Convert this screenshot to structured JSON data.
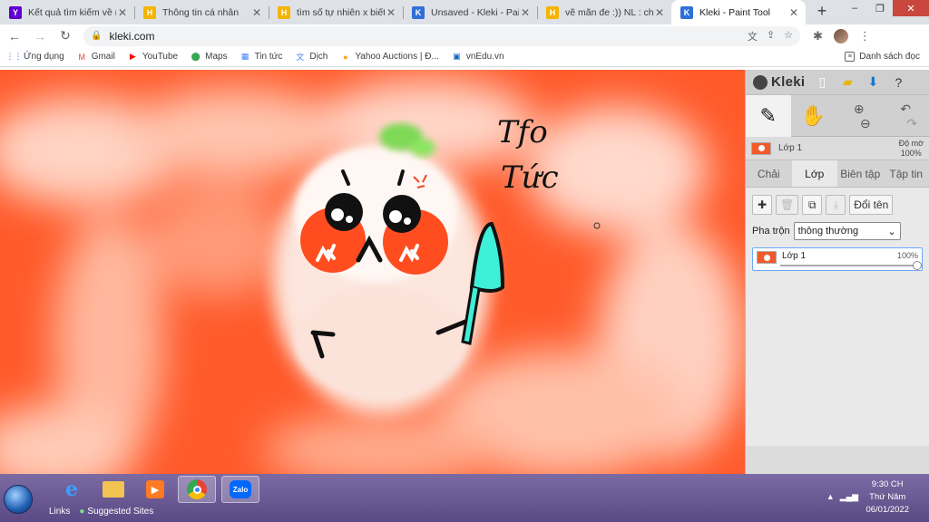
{
  "browser": {
    "tabs": [
      {
        "title": "Kết quả tìm kiếm về nếu",
        "fav": "Y",
        "fav_color": "#5f01d1"
      },
      {
        "title": "Thông tin cá nhân",
        "fav": "H",
        "fav_color": "#f5b400"
      },
      {
        "title": "tìm số tự nhiên x biết a)",
        "fav": "H",
        "fav_color": "#f5b400"
      },
      {
        "title": "Unsaved - Kleki - Paint T",
        "fav": "K",
        "fav_color": "#2f6fd6"
      },
      {
        "title": "vẽ mãn đe :)) NL : chân d",
        "fav": "H",
        "fav_color": "#f5b400"
      },
      {
        "title": "Kleki - Paint Tool",
        "fav": "K",
        "fav_color": "#2f6fd6"
      }
    ],
    "url": "kleki.com",
    "bookmarks": [
      {
        "label": "Ứng dụng",
        "icon": "apps-grid-icon"
      },
      {
        "label": "Gmail",
        "icon": "gmail-icon"
      },
      {
        "label": "YouTube",
        "icon": "youtube-icon"
      },
      {
        "label": "Maps",
        "icon": "maps-icon"
      },
      {
        "label": "Tin tức",
        "icon": "news-icon"
      },
      {
        "label": "Dịch",
        "icon": "translate-icon"
      },
      {
        "label": "Yahoo Auctions | Đ...",
        "icon": "yahoo-icon"
      },
      {
        "label": "vnEdu.vn",
        "icon": "vnedu-icon"
      }
    ],
    "reading_list": "Danh sách đọc"
  },
  "kleki": {
    "logo": "Kleki",
    "layer_name": "Lớp 1",
    "opacity_label": "Độ mờ",
    "opacity_value": "100%",
    "tabs": [
      "Chải",
      "Lớp",
      "Biên tập",
      "Tập tin"
    ],
    "active_tab": 1,
    "rename_button": "Đổi tên",
    "blend_label": "Pha trộn",
    "blend_value": "thông thường",
    "layers": [
      {
        "name": "Lớp 1",
        "opacity": "100%"
      }
    ]
  },
  "drawing": {
    "text_line1": "Tfo",
    "text_line2": "Tức",
    "colors": {
      "bg": "#ff5a2a",
      "body": "#fbe7df",
      "leaf": "#7ed957",
      "knife": "#3ff0d8"
    }
  },
  "taskbar": {
    "links": "Links",
    "suggested_sites": "Suggested Sites",
    "time": "9:30 CH",
    "day": "Thứ Năm",
    "date": "06/01/2022"
  }
}
